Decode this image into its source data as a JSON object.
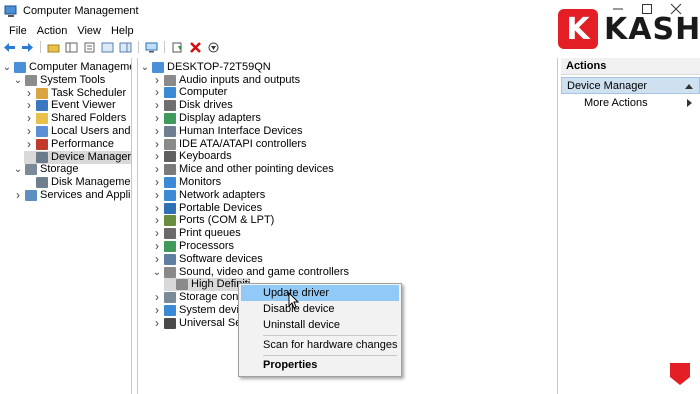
{
  "window": {
    "title": "Computer Management",
    "menu": [
      "File",
      "Action",
      "View",
      "Help"
    ]
  },
  "left_tree": [
    {
      "label": "Computer Management (Local",
      "icon": "computer-management-icon",
      "indent": 0,
      "twisty": "expanded"
    },
    {
      "label": "System Tools",
      "icon": "tools-icon",
      "indent": 1,
      "twisty": "expanded"
    },
    {
      "label": "Task Scheduler",
      "icon": "clock-icon",
      "indent": 2,
      "twisty": "collapsed"
    },
    {
      "label": "Event Viewer",
      "icon": "event-viewer-icon",
      "indent": 2,
      "twisty": "collapsed"
    },
    {
      "label": "Shared Folders",
      "icon": "folder-icon",
      "indent": 2,
      "twisty": "collapsed"
    },
    {
      "label": "Local Users and Groups",
      "icon": "users-icon",
      "indent": 2,
      "twisty": "collapsed"
    },
    {
      "label": "Performance",
      "icon": "performance-icon",
      "indent": 2,
      "twisty": "collapsed"
    },
    {
      "label": "Device Manager",
      "icon": "device-manager-icon",
      "indent": 2,
      "twisty": "none",
      "selected": true
    },
    {
      "label": "Storage",
      "icon": "storage-icon",
      "indent": 1,
      "twisty": "expanded"
    },
    {
      "label": "Disk Management",
      "icon": "disk-icon",
      "indent": 2,
      "twisty": "none"
    },
    {
      "label": "Services and Applications",
      "icon": "services-icon",
      "indent": 1,
      "twisty": "collapsed"
    }
  ],
  "device_tree": {
    "root": "DESKTOP-72T59QN",
    "items": [
      {
        "label": "Audio inputs and outputs",
        "icon": "speaker-icon"
      },
      {
        "label": "Computer",
        "icon": "monitor-icon"
      },
      {
        "label": "Disk drives",
        "icon": "disk-drive-icon"
      },
      {
        "label": "Display adapters",
        "icon": "display-adapter-icon"
      },
      {
        "label": "Human Interface Devices",
        "icon": "hid-icon"
      },
      {
        "label": "IDE ATA/ATAPI controllers",
        "icon": "ide-icon"
      },
      {
        "label": "Keyboards",
        "icon": "keyboard-icon"
      },
      {
        "label": "Mice and other pointing devices",
        "icon": "mouse-icon"
      },
      {
        "label": "Monitors",
        "icon": "monitor-icon"
      },
      {
        "label": "Network adapters",
        "icon": "network-icon"
      },
      {
        "label": "Portable Devices",
        "icon": "portable-icon"
      },
      {
        "label": "Ports (COM & LPT)",
        "icon": "port-icon"
      },
      {
        "label": "Print queues",
        "icon": "printer-icon"
      },
      {
        "label": "Processors",
        "icon": "processor-icon"
      },
      {
        "label": "Software devices",
        "icon": "software-icon"
      },
      {
        "label": "Sound, video and game controllers",
        "icon": "speaker-icon",
        "expanded": true
      },
      {
        "label": "High Definiti",
        "icon": "speaker-icon",
        "child": true,
        "selected": true
      },
      {
        "label": "Storage control",
        "icon": "storage-icon"
      },
      {
        "label": "System devices",
        "icon": "system-icon"
      },
      {
        "label": "Universal Serial",
        "icon": "usb-icon"
      }
    ]
  },
  "context_menu": {
    "items": [
      "Update driver",
      "Disable device",
      "Uninstall device",
      "Scan for hardware changes",
      "Properties"
    ]
  },
  "actions": {
    "header": "Actions",
    "section": "Device Manager",
    "more": "More Actions"
  },
  "logo": {
    "letter": "K",
    "text": "KASHI"
  },
  "colors": {
    "selection": "#91c9f7",
    "brand": "#e31e24",
    "accent_blue": "#1e6fd9"
  }
}
